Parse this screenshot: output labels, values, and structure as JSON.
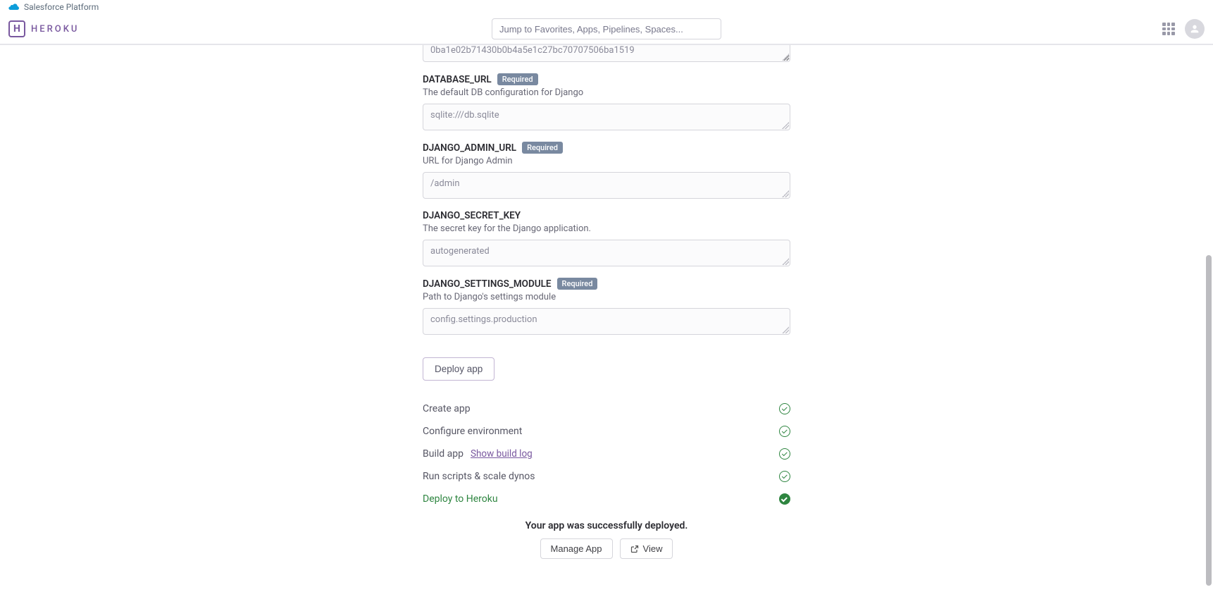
{
  "platform": {
    "label": "Salesforce Platform"
  },
  "brand": {
    "name": "HEROKU"
  },
  "search": {
    "placeholder": "Jump to Favorites, Apps, Pipelines, Spaces..."
  },
  "fields": {
    "prev": {
      "value": "0ba1e02b71430b0b4a5e1c27bc70707506ba1519"
    },
    "database_url": {
      "label": "DATABASE_URL",
      "required": "Required",
      "desc": "The default DB configuration for Django",
      "value": "sqlite:///db.sqlite"
    },
    "django_admin_url": {
      "label": "DJANGO_ADMIN_URL",
      "required": "Required",
      "desc": "URL for Django Admin",
      "value": "/admin"
    },
    "django_secret_key": {
      "label": "DJANGO_SECRET_KEY",
      "desc": "The secret key for the Django application.",
      "value": "autogenerated"
    },
    "django_settings_module": {
      "label": "DJANGO_SETTINGS_MODULE",
      "required": "Required",
      "desc": "Path to Django's settings module",
      "value": "config.settings.production"
    }
  },
  "deploy": {
    "button": "Deploy app"
  },
  "steps": {
    "create_app": "Create app",
    "configure_env": "Configure environment",
    "build_app": "Build app",
    "build_log": "Show build log",
    "run_scripts": "Run scripts & scale dynos",
    "deploy_heroku": "Deploy to Heroku"
  },
  "result": {
    "message": "Your app was successfully deployed.",
    "manage": "Manage App",
    "view": "View"
  }
}
